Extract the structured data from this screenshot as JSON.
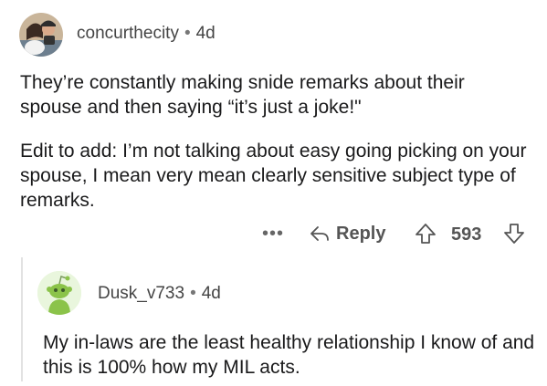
{
  "comment1": {
    "username": "concurthecity",
    "separator": "•",
    "age": "4d",
    "paragraph1": "They’re constantly making snide remarks about their spouse and then saying “it’s just a joke!\"",
    "paragraph2": "Edit to add: I’m not talking about easy going picking on your spouse, I mean very mean clearly sensitive subject type of remarks.",
    "actions": {
      "more": "•••",
      "reply_label": "Reply",
      "score": "593"
    }
  },
  "comment2": {
    "username": "Dusk_v733",
    "separator": "•",
    "age": "4d",
    "paragraph1": "My in-laws are the least healthy relationship I know of and this is 100% how my MIL acts."
  },
  "icons": {
    "reply": "reply-arrow-icon",
    "upvote": "upvote-arrow-icon",
    "downvote": "downvote-arrow-icon",
    "more": "more-dots-icon"
  },
  "colors": {
    "text": "#1a1a1b",
    "meta": "#444444",
    "action": "#555555",
    "snoo_bg": "#e9f6dd",
    "snoo_green": "#8bc34a"
  }
}
